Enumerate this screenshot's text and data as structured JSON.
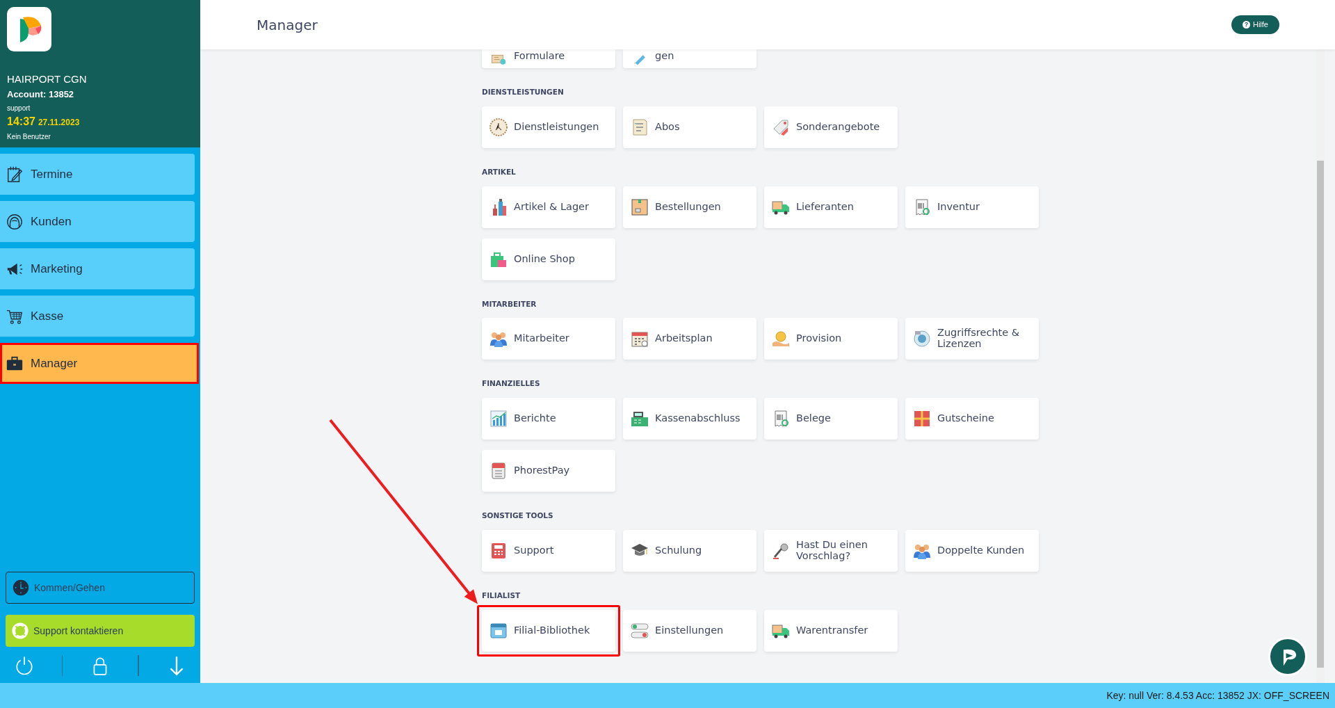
{
  "sidebar": {
    "account": {
      "salon": "HAIRPORT CGN",
      "account": "Account: 13852",
      "user": "support",
      "time": "14:37",
      "date": "27.11.2023",
      "employee": "Kein Benutzer"
    },
    "nav": [
      {
        "label": "Termine",
        "selected": false,
        "highlighted": false
      },
      {
        "label": "Kunden",
        "selected": false,
        "highlighted": false
      },
      {
        "label": "Marketing",
        "selected": false,
        "highlighted": false
      },
      {
        "label": "Kasse",
        "selected": false,
        "highlighted": false
      },
      {
        "label": "Manager",
        "selected": true,
        "highlighted": true
      }
    ],
    "clock_button": "Kommen/Gehen",
    "support_button": "Support kontaktieren"
  },
  "header": {
    "title": "Manager",
    "help_icon": "?",
    "help_button": "Hilfe"
  },
  "partial_row": [
    "Formulare",
    "gen"
  ],
  "sections": [
    {
      "title": "DIENSTLEISTUNGEN",
      "tiles": [
        {
          "label": "Dienstleistungen",
          "highlighted": false
        },
        {
          "label": "Abos",
          "highlighted": false
        },
        {
          "label": "Sonderangebote",
          "highlighted": false
        }
      ]
    },
    {
      "title": "ARTIKEL",
      "tiles": [
        {
          "label": "Artikel & Lager",
          "highlighted": false
        },
        {
          "label": "Bestellungen",
          "highlighted": false
        },
        {
          "label": "Lieferanten",
          "highlighted": false
        },
        {
          "label": "Inventur",
          "highlighted": false
        },
        {
          "label": "Online Shop",
          "highlighted": false
        }
      ]
    },
    {
      "title": "MITARBEITER",
      "tiles": [
        {
          "label": "Mitarbeiter",
          "highlighted": false
        },
        {
          "label": "Arbeitsplan",
          "highlighted": false
        },
        {
          "label": "Provision",
          "highlighted": false
        },
        {
          "label": "Zugriffsrechte & Lizenzen",
          "highlighted": false
        }
      ]
    },
    {
      "title": "FINANZIELLES",
      "tiles": [
        {
          "label": "Berichte",
          "highlighted": false
        },
        {
          "label": "Kassenabschluss",
          "highlighted": false
        },
        {
          "label": "Belege",
          "highlighted": false
        },
        {
          "label": "Gutscheine",
          "highlighted": false
        },
        {
          "label": "PhorestPay",
          "highlighted": false
        }
      ]
    },
    {
      "title": "SONSTIGE TOOLS",
      "tiles": [
        {
          "label": "Support",
          "highlighted": false
        },
        {
          "label": "Schulung",
          "highlighted": false
        },
        {
          "label": "Hast Du einen Vorschlag?",
          "highlighted": false
        },
        {
          "label": "Doppelte Kunden",
          "highlighted": false
        }
      ]
    },
    {
      "title": "FILIALIST",
      "tiles": [
        {
          "label": "Filial-Bibliothek",
          "highlighted": true
        },
        {
          "label": "Einstellungen",
          "highlighted": false
        },
        {
          "label": "Warentransfer",
          "highlighted": false
        }
      ]
    }
  ],
  "status_bar": "Key: null Ver: 8.4.53 Acc: 13852  JX: OFF_SCREEN"
}
